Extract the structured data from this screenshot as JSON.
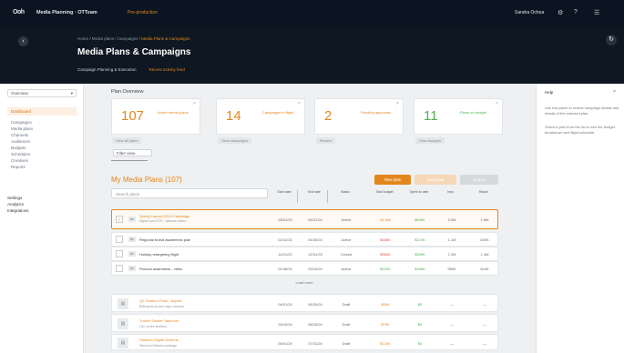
{
  "topbar": {
    "logo": "Ooh",
    "app": "Media Planning · OTTeam",
    "env": "Pre-production",
    "user": "Sandra Ochoa",
    "icons": [
      "bell-icon",
      "help-icon",
      "apps-icon"
    ]
  },
  "header": {
    "breadcrumb_prefix": "Home / Media plans / Campaigns / ",
    "breadcrumb_active": "Media Plans & Campaigns",
    "title": "Media Plans & Campaigns",
    "sub_left": "Campaign Planning & Execution",
    "sub_right": "Recent activity feed"
  },
  "leftnav": {
    "select": "Overview",
    "active": "Dashboard",
    "items": [
      "Campaigns",
      "Media plans",
      "Channels",
      "Audiences",
      "Budgets",
      "Schedules",
      "Creatives",
      "Reports"
    ],
    "groups": [
      "Settings",
      "Analytics",
      "Integrations"
    ]
  },
  "rightpanel": {
    "title": "Help",
    "paragraphs": [
      "Use this panel to review campaign details and details of the selected plan.",
      "Select a plan from the list to see the budget breakdown and flight schedule."
    ]
  },
  "section_title": "Plan Overview",
  "kpis": [
    {
      "value": "107",
      "label": "Active media plans",
      "link": "View all plans"
    },
    {
      "value": "14",
      "label": "Campaigns in flight",
      "link": "View campaigns"
    },
    {
      "value": "2",
      "label": "Pending approvals",
      "link": "Review"
    },
    {
      "value": "11",
      "label": "Plans on budget",
      "link": "View budgets"
    }
  ],
  "filter_button": "Filter view",
  "list_title": "My Media Plans (107)",
  "buttons": {
    "primary": "New plan",
    "secondary": "Duplicate",
    "tertiary": "Export"
  },
  "table": {
    "search_placeholder": "Search plans",
    "headers": [
      "Start date",
      "End date",
      "Status",
      "Total budget",
      "Spent to date",
      "Impr.",
      "Reach"
    ],
    "rows": [
      {
        "tag": "MP",
        "name": "Spring Launch 2024 Campaign",
        "desc": "Digital and OOH - national rollout",
        "cells": [
          "03/01/24",
          "05/31/24",
          "Active",
          "$1.2M",
          "$640K",
          "3.4M",
          "1.9M"
        ],
        "highlight": true
      },
      {
        "tag": "MP",
        "name": "Regional brand awareness plan",
        "desc": "",
        "cells": [
          "02/12/24",
          "04/30/24",
          "Active",
          "$480K",
          "$210K",
          "1.1M",
          "820K"
        ]
      },
      {
        "tag": "MP",
        "name": "Holiday retargeting flight",
        "desc": "",
        "cells": [
          "11/01/23",
          "12/31/23",
          "Closed",
          "$350K",
          "$349K",
          "2.2M",
          "1.4M"
        ]
      },
      {
        "tag": "MP",
        "name": "Product awareness - video",
        "desc": "",
        "cells": [
          "01/08/24",
          "03/15/24",
          "Active",
          "$220K",
          "$185K",
          "980K",
          "610K"
        ]
      }
    ],
    "more_label": "Load more",
    "campaigns": [
      {
        "name": "Q2 Outdoor Push - Airport",
        "desc": "Billboards across major airports",
        "cells": [
          "04/01/24",
          "06/30/24",
          "Draft",
          "$90K",
          "$0",
          "—",
          "—"
        ]
      },
      {
        "name": "Transit Shelter Takeover",
        "desc": "City centre shelters",
        "cells": [
          "03/15/24",
          "05/15/24",
          "Draft",
          "$75K",
          "$0",
          "—",
          "—"
        ]
      },
      {
        "name": "Stadium Digital Screens",
        "desc": "Weekend fixtures package",
        "cells": [
          "05/01/24",
          "07/31/24",
          "Draft",
          "$120K",
          "$0",
          "—",
          "—"
        ]
      }
    ]
  }
}
